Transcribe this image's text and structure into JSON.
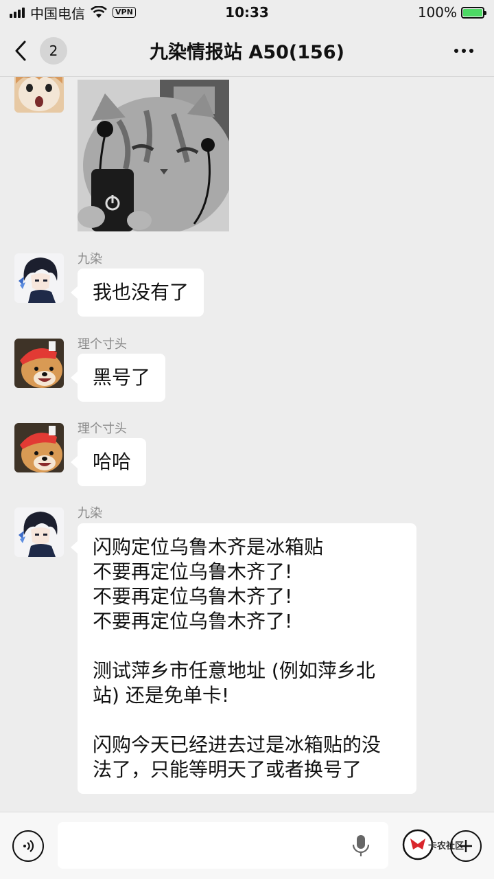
{
  "status_bar": {
    "carrier": "中国电信",
    "vpn": "VPN",
    "time": "10:33",
    "battery": "100%",
    "battery_level": 1.0
  },
  "nav": {
    "unread_count": "2",
    "title": "九染情报站 A50(156)"
  },
  "messages": [
    {
      "type": "sticker",
      "sender": "",
      "avatar": "kitten-avatar"
    },
    {
      "type": "text",
      "sender": "九染",
      "avatar": "anime-boy-avatar",
      "text": "我也没有了"
    },
    {
      "type": "text",
      "sender": "理个寸头",
      "avatar": "shiba-dog-avatar",
      "text": "黑号了"
    },
    {
      "type": "text",
      "sender": "理个寸头",
      "avatar": "shiba-dog-avatar",
      "text": "哈哈"
    },
    {
      "type": "text",
      "sender": "九染",
      "avatar": "anime-boy-avatar",
      "text": "闪购定位乌鲁木齐是冰箱贴\n不要再定位乌鲁木齐了!\n不要再定位乌鲁木齐了!\n不要再定位乌鲁木齐了!\n\n测试萍乡市任意地址 (例如萍乡北\n站) 还是免单卡!\n\n闪购今天已经进去过是冰箱贴的没\n法了，只能等明天了或者换号了"
    }
  ],
  "input_bar": {
    "placeholder": "",
    "watermark": "卡农社区"
  },
  "colors": {
    "background": "#ededed",
    "bubble": "#ffffff",
    "sender_name": "#8a8a8a",
    "battery": "#4cd964"
  }
}
